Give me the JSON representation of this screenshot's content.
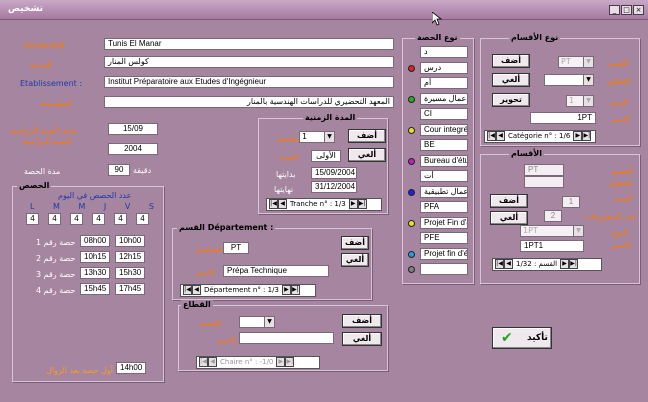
{
  "window": {
    "title": "تشخيص",
    "buttons": [
      "_",
      "□",
      "×"
    ]
  },
  "establishment": {
    "name_label": "Université",
    "name_value": "Tunis El Manar",
    "city_label": "المدينة",
    "city_value": "كولس المنار",
    "etab_label": "Etablissement :",
    "etab_fr_value": "Institut Préparatoire aux Etudes d'Ingégnieur",
    "etab_ar_label": "المؤسسة",
    "etab_ar_value": "المعهد التحضيري للدراسات الهندسية بالمنار"
  },
  "year": {
    "start_label": "بداية السنة الدراسية",
    "start_value": "15/09",
    "year_label": "السنة الدراسية",
    "year_value": "2004",
    "duration_label": "مدة الحصة",
    "duration_unit": "دقيقة",
    "duration_value": "90"
  },
  "sessions": {
    "title": "الحصص",
    "per_day_label": "عدد الحصص في اليوم",
    "days": [
      "L",
      "M",
      "M",
      "J",
      "V",
      "S"
    ],
    "counts": [
      "4",
      "4",
      "4",
      "4",
      "4",
      "4"
    ],
    "rows": [
      {
        "label": "حصة رقم 1",
        "start": "08h00",
        "end": "10h00"
      },
      {
        "label": "حصة رقم 2",
        "start": "10h15",
        "end": "12h15"
      },
      {
        "label": "حصة رقم 3",
        "start": "13h30",
        "end": "15h30"
      },
      {
        "label": "حصة رقم 4",
        "start": "15h45",
        "end": "17h45"
      }
    ],
    "first_after_label": "أول حصة بعد الزوال",
    "first_after_value": "14h00"
  },
  "period": {
    "title": "المدة الزمنية",
    "num_label": "التسلسل",
    "num_value": "1",
    "name_label": "المدة",
    "name_value": "الأولى",
    "start_label": "بدايتها",
    "start_value": "15/09/2004",
    "end_label": "نهايتها",
    "end_value": "31/12/2004",
    "add_btn": "أضف",
    "cancel_btn": "ألغي",
    "nav": "Tranche n° : 1/3"
  },
  "department": {
    "title": "القسم Département :",
    "code_label": "التسلسل",
    "code_value": "PT",
    "name_label": "الاسم",
    "name_value": "Prépa Technique",
    "add_btn": "أضف",
    "cancel_btn": "ألغي",
    "nav": "Département n° : 1/3"
  },
  "chair": {
    "title": "القطاع",
    "dept_label": "القسم",
    "name_label": "الاسم",
    "add_btn": "أضف",
    "cancel_btn": "ألغي",
    "nav": "Chaire n° : -1/0"
  },
  "session_types": {
    "title": "نوع الحصة",
    "items": [
      {
        "text": "د",
        "color": ""
      },
      {
        "text": "درس",
        "color": "#e02020"
      },
      {
        "text": "أم",
        "color": ""
      },
      {
        "text": "أعمال مسيرة",
        "color": "#20b020"
      },
      {
        "text": "CI",
        "color": ""
      },
      {
        "text": "Cour integré",
        "color": "#e8e020"
      },
      {
        "text": "BE",
        "color": ""
      },
      {
        "text": "Bureau d'étude",
        "color": "#c020c0"
      },
      {
        "text": "أت",
        "color": ""
      },
      {
        "text": "أعمال تطبيقية",
        "color": "#2020e0"
      },
      {
        "text": "PFA",
        "color": ""
      },
      {
        "text": "Projet Fin d'an",
        "color": "#e8e020"
      },
      {
        "text": "PFE",
        "color": ""
      },
      {
        "text": "Projet fin d'étu",
        "color": "#20a0e0"
      },
      {
        "text": "",
        "color": "#808080"
      }
    ]
  },
  "categories": {
    "title": "نوع الأقسام",
    "dept_label": "القسم",
    "dept_value": "PT",
    "sector_label": "القطاع",
    "year_label": "السنة",
    "year_value": "1",
    "name_label": "الاسم",
    "name_value": "1PT",
    "add_btn": "أضف",
    "cancel_btn": "ألغي",
    "modify_btn": "تحوير",
    "nav": "Catégorie n° : 1/6"
  },
  "classes": {
    "title": "الأقسام",
    "dept_label": "القسم",
    "dept_value": "PT",
    "sector_label": "القطاع",
    "year_label": "السنة",
    "year_value": "1",
    "groups_label": "عدد المجموعات",
    "groups_value": "2",
    "type_label": "النوع",
    "type_value": "1PT",
    "name_label": "الاسم",
    "name_value": "1PT1",
    "add_btn": "أضف",
    "cancel_btn": "ألغي",
    "nav": "القسم : 1/32"
  },
  "confirm_btn": "تأكيد"
}
